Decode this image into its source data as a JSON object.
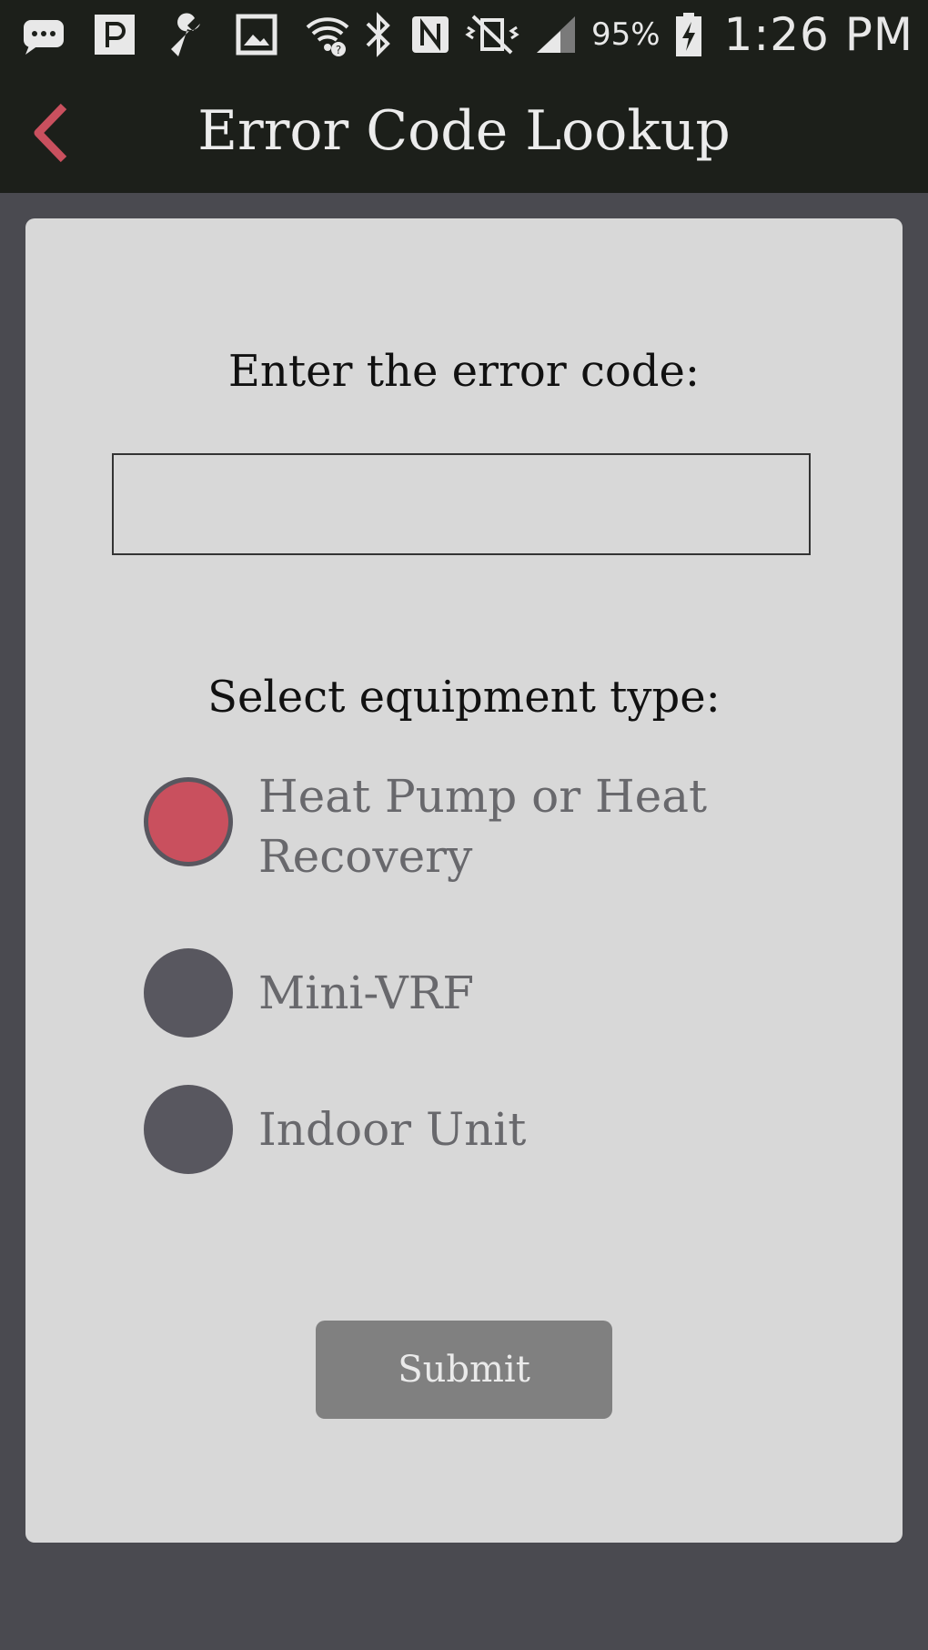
{
  "status_bar": {
    "icons": [
      "message-icon",
      "pandora-icon",
      "wrench-icon",
      "image-icon",
      "wifi-icon",
      "bluetooth-icon",
      "nfc-icon",
      "vibrate-mute-icon",
      "signal-icon",
      "battery-charging-icon"
    ],
    "battery_percent": "95%",
    "time": "1:26 PM"
  },
  "app_bar": {
    "title": "Error Code Lookup",
    "back_icon": "chevron-left-icon",
    "accent_color": "#c9505e"
  },
  "form": {
    "code_label": "Enter the error code:",
    "code_value": "",
    "equipment_label": "Select equipment type:",
    "options": [
      {
        "label": "Heat Pump or Heat Recovery",
        "selected": true
      },
      {
        "label": "Mini-VRF",
        "selected": false
      },
      {
        "label": "Indoor Unit",
        "selected": false
      }
    ],
    "submit_label": "Submit"
  }
}
